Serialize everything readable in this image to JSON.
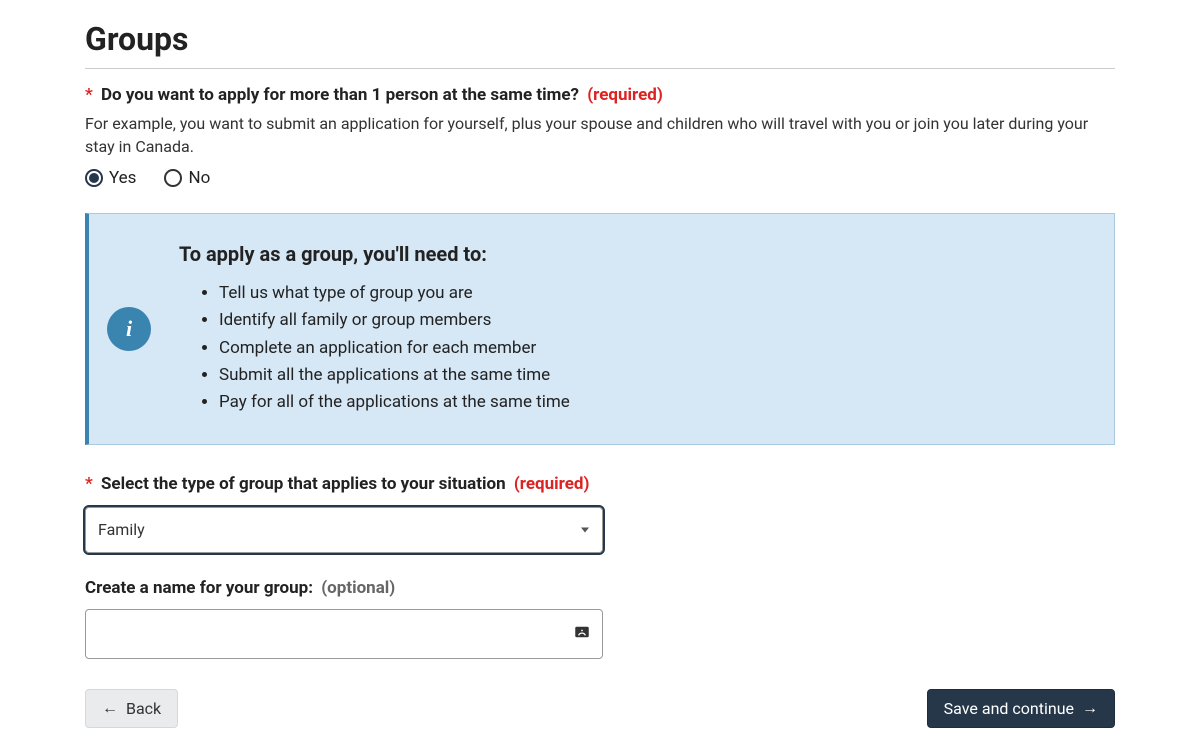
{
  "page": {
    "title": "Groups"
  },
  "q1": {
    "label_text": "Do you want to apply for more than 1 person at the same time?",
    "required": "(required)",
    "help": "For example, you want to submit an application for yourself, plus your spouse and children who will travel with you or join you later during your stay in Canada.",
    "yes": "Yes",
    "no": "No"
  },
  "info_panel": {
    "heading": "To apply as a group, you'll need to:",
    "items": [
      "Tell us what type of group you are",
      "Identify all family or group members",
      "Complete an application for each member",
      "Submit all the applications at the same time",
      "Pay for all of the applications at the same time"
    ]
  },
  "group_type": {
    "label_text": "Select the type of group that applies to your situation",
    "required": "(required)",
    "selected": "Family"
  },
  "group_name": {
    "label_text": "Create a name for your group:",
    "optional": "(optional)",
    "value": ""
  },
  "buttons": {
    "back": "Back",
    "continue": "Save and continue"
  }
}
